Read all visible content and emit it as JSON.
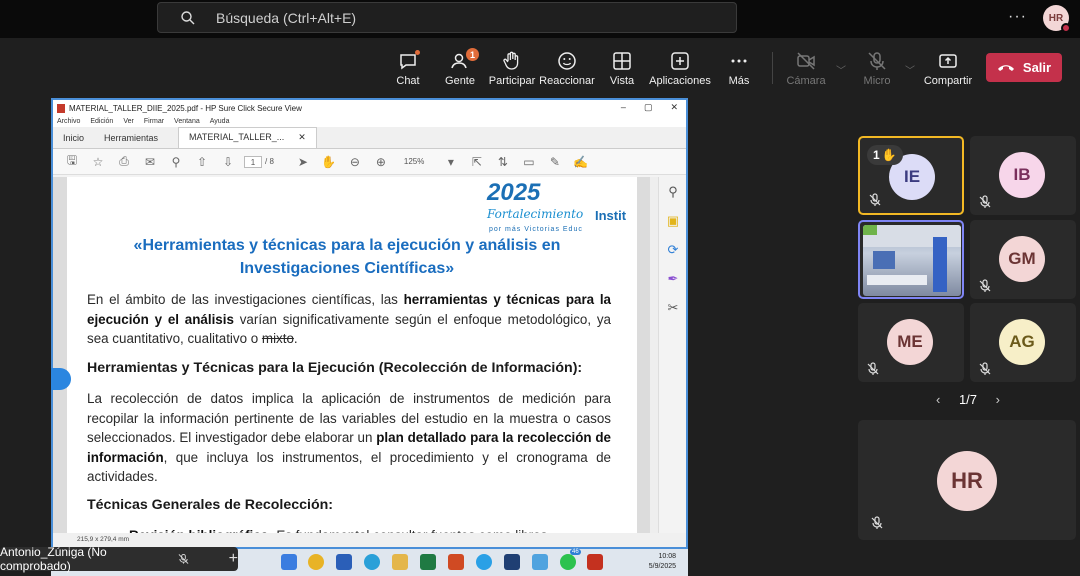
{
  "search": {
    "placeholder": "Búsqueda (Ctrl+Alt+E)"
  },
  "user": {
    "initials": "HR"
  },
  "toolbar": {
    "chat": "Chat",
    "people": "Gente",
    "people_count": "1",
    "raise": "Participar",
    "react": "Reaccionar",
    "view": "Vista",
    "apps": "Aplicaciones",
    "more": "Más",
    "camera": "Cámara",
    "mic": "Micro",
    "share": "Compartir",
    "leave": "Salir"
  },
  "pdf": {
    "window_title": "MATERIAL_TALLER_DIIE_2025.pdf - HP Sure Click Secure View",
    "menus": [
      "Archivo",
      "Edición",
      "Ver",
      "Firmar",
      "Ventana",
      "Ayuda"
    ],
    "tabs": {
      "home": "Inicio",
      "tools": "Herramientas",
      "file": "MATERIAL_TALLER_..."
    },
    "page_current": "1",
    "page_total": "/ 8",
    "zoom": "125%",
    "page_size": "215,9 x 279,4 mm",
    "logo_year": "2025",
    "logo_script": "Fortalecimiento",
    "logo_inst": "Instit",
    "logo_slogan": "por más Victorias Educ",
    "title_line1": "«Herramientas y técnicas para la ejecución y análisis en",
    "title_line2": "Investigaciones Científicas»",
    "p1_a": "En el ámbito de las investigaciones científicas, las ",
    "p1_b": "herramientas y técnicas para la ejecución y el análisis",
    "p1_c": " varían significativamente según el enfoque metodológico, ya sea cuantitativo, cualitativo o ",
    "p1_d": "mixto",
    "p1_e": ".",
    "h1": "Herramientas y Técnicas para la Ejecución (Recolección de Información):",
    "p2_a": "La recolección de datos implica la aplicación de instrumentos de medición para recopilar la información pertinente de las variables del estudio en la muestra o casos seleccionados. El investigador debe elaborar un ",
    "p2_b": "plan detallado para la recolección de información",
    "p2_c": ", que incluya los instrumentos, el procedimiento y el cronograma de actividades.",
    "h2": "Técnicas Generales de Recolección:",
    "p3_a": "Revisión bibliográfica:",
    "p3_b": " Es fundamental consultar fuentes como libros"
  },
  "taskbar": {
    "time": "10:08",
    "date": "5/9/2025",
    "badge": "46"
  },
  "presenter": {
    "name": "Antonio_Zúniga (No comprobado)"
  },
  "participants": [
    {
      "initials": "IE",
      "hand_count": "1",
      "color": "#dcdcf7",
      "text": "#3b3b80"
    },
    {
      "initials": "IB",
      "color": "#f7d6ea",
      "text": "#7a2e5c"
    },
    {
      "initials": "",
      "color": "#000000",
      "text": "#000000"
    },
    {
      "initials": "GM",
      "color": "#f3d6d6",
      "text": "#6b3434"
    },
    {
      "initials": "ME",
      "color": "#f3d6d6",
      "text": "#6b3434"
    },
    {
      "initials": "AG",
      "color": "#f7efc8",
      "text": "#6b5a1a"
    }
  ],
  "pager": {
    "label": "1/7"
  },
  "self": {
    "initials": "HR"
  }
}
